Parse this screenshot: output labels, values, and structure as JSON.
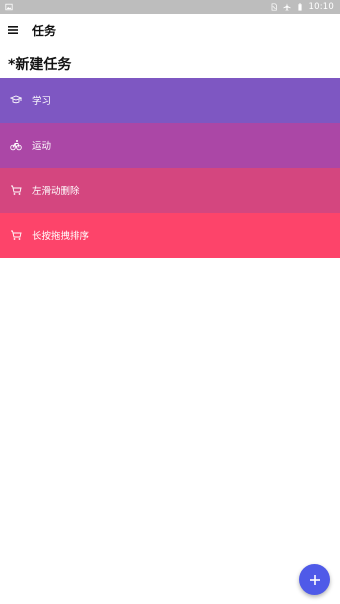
{
  "status_bar": {
    "time": "10:10",
    "icons": [
      "image-icon",
      "sim-icon",
      "airplane-icon",
      "battery-icon"
    ]
  },
  "app_bar": {
    "title": "任务",
    "menu_icon": "hamburger-menu-icon"
  },
  "section": {
    "title": "*新建任务"
  },
  "tasks": [
    {
      "label": "学习",
      "icon": "graduation-cap-icon",
      "color": "#7e57c2"
    },
    {
      "label": "运动",
      "icon": "bike-icon",
      "color": "#ab47a6"
    },
    {
      "label": "左滑动删除",
      "icon": "cart-icon",
      "color": "#d4467f"
    },
    {
      "label": "长按拖拽排序",
      "icon": "cart-icon",
      "color": "#fd446a"
    }
  ],
  "fab": {
    "icon": "plus-icon",
    "color": "#4f5ae8"
  }
}
